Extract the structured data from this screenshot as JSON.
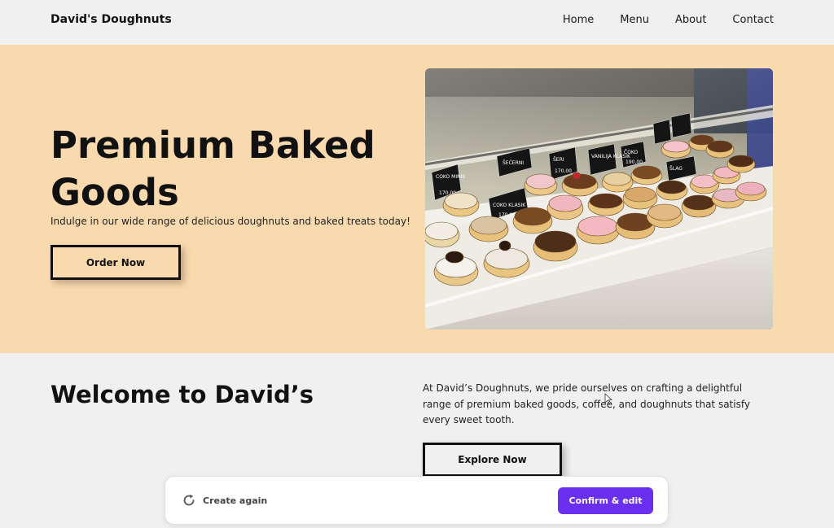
{
  "nav": {
    "brand": "David's Doughnuts",
    "links": [
      "Home",
      "Menu",
      "About",
      "Contact"
    ]
  },
  "hero": {
    "title": "Premium Baked Goods",
    "subtitle": "Indulge in our wide range of delicious doughnuts and baked treats today!",
    "cta": "Order Now",
    "image_labels": [
      "COKO MINIS",
      "COKO KLASIK",
      "ŠEĆERNI",
      "VANILIJA KLASIK",
      "ŠERI",
      "ČOKO",
      "ŠLAG"
    ],
    "image_prices": [
      "170,00",
      "170,00",
      "170,00",
      "190,00"
    ]
  },
  "welcome": {
    "title": "Welcome to David’s",
    "text": "At David’s Doughnuts, we pride ourselves on crafting a delightful range of premium baked goods, coffee, and doughnuts that satisfy every sweet tooth.",
    "cta": "Explore Now"
  },
  "bottom_bar": {
    "create_again": "Create again",
    "confirm": "Confirm & edit"
  },
  "colors": {
    "hero_bg": "#f9d9ae",
    "page_bg": "#f0f0f0",
    "confirm_bg": "#6b2ff0"
  }
}
